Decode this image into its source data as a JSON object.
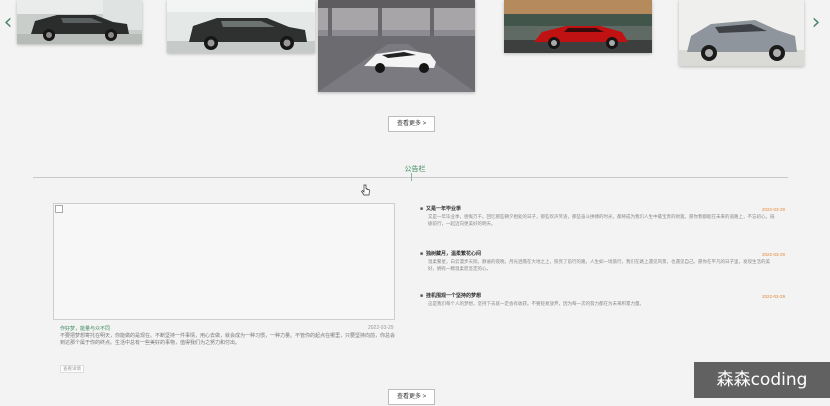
{
  "carousel": {
    "prev_label": "‹",
    "next_label": "›",
    "slides": [
      {
        "name": "car-photo-dark-suv-showroom",
        "bg": "#6f7570",
        "body": "#2b2d2c"
      },
      {
        "name": "car-photo-grey-suv-showroom",
        "bg": "#e7ebea",
        "body": "#2f3130"
      },
      {
        "name": "car-photo-white-lamborghini",
        "bg": "#8c8c92",
        "body": "#f4f4f4"
      },
      {
        "name": "car-photo-red-ferrari",
        "bg": "#5a5f5c",
        "body": "#c01212"
      },
      {
        "name": "car-photo-silver-bmw",
        "bg": "#ebebe9",
        "body": "#8f959c"
      }
    ]
  },
  "more_button_top": "查看更多 >",
  "notice": {
    "title": "公告栏",
    "caption": "作好梦，能量与众不同",
    "caption_date": "2022-03-29",
    "excerpt": "不要把梦想寄托在明天，你能做的是现在。不断坚持一件事情，用心去做，就会成为一种习惯，一种力量。不管你的起点在哪里，只要坚持向前，你总会到达那个属于你的终点。生活中总有一些美好的事物，值得我们为之努力和付出。",
    "readmore": "查看详情",
    "items": [
      {
        "title": "又是一年毕业季",
        "date": "2022-03-29",
        "body": "又是一年毕业季，感慨万千。回忆那些朝夕相处的日子，那些欢声笑语，那些奋斗拼搏的时光，都将成为我们人生中最宝贵的财富。愿你我都能在未来的道路上，不忘初心，砥砺前行，一起迈向更美好的明天。"
      },
      {
        "title": "独树藏月，温柔繁花心间",
        "date": "2022-03-29",
        "body": "温柔繁星，白云漫步天际。静谧的夜晚，月光洒落在大地之上，照亮了前行的路。人生如一场旅行，我们在路上遇见风景，也遇见自己。愿你在平凡的日子里，发现生活的美好，拥有一颗温柔而坚定的心。"
      },
      {
        "title": "挂机围观一个坚持的梦想",
        "date": "2022-03-29",
        "body": "这是我们每个人的梦想，坚持下去就一定会有收获。不要轻易放弃，因为每一次的努力都在为未来积累力量。"
      }
    ]
  },
  "more_button_bottom": "查看更多 >",
  "watermark": "森森coding"
}
